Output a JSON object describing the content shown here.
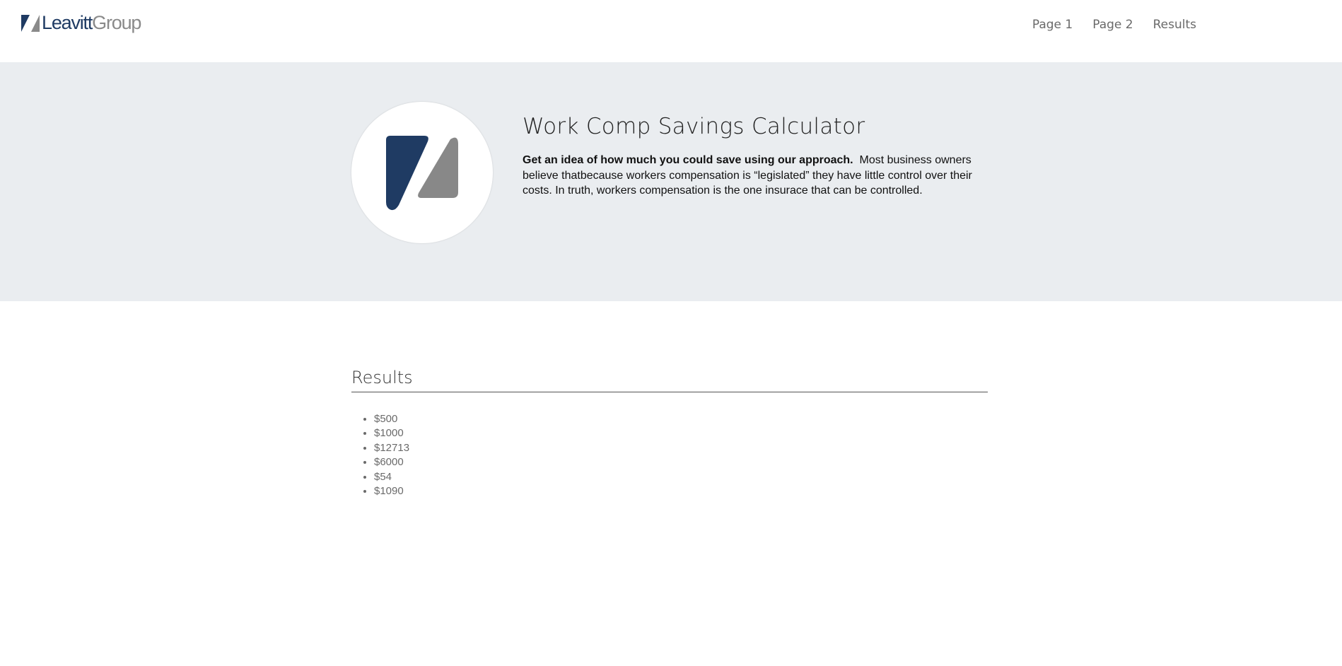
{
  "brand": {
    "name_part1": "Leavitt",
    "name_part2": "Group",
    "primary_color": "#1f3b63",
    "secondary_color": "#8a8a8a"
  },
  "nav": {
    "items": [
      {
        "label": "Page 1"
      },
      {
        "label": "Page 2"
      },
      {
        "label": "Results"
      }
    ]
  },
  "hero": {
    "title": "Work Comp Savings Calculator",
    "lead_bold": "Get an idea of how much you could save using our approach.",
    "body": "Most business owners believe thatbecause workers compensation is “legislated” they have little control over their costs. In truth, workers compensation is the one insurace that can be controlled.",
    "background_color": "#eaedf0",
    "icon": "leavitt-logo-icon"
  },
  "results": {
    "title": "Results",
    "items": [
      "$500",
      "$1000",
      "$12713",
      "$6000",
      "$54",
      "$1090"
    ]
  }
}
